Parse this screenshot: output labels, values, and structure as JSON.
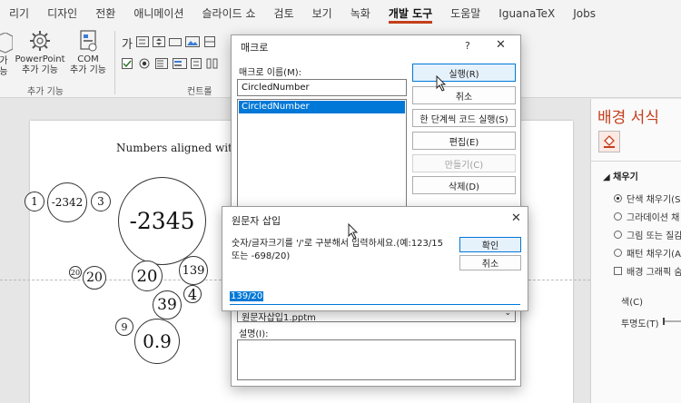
{
  "ribbon_tabs": [
    "리기",
    "디자인",
    "전환",
    "애니메이션",
    "슬라이드 쇼",
    "검토",
    "보기",
    "녹화",
    "개발 도구",
    "도움말",
    "IguanaTeX",
    "Jobs"
  ],
  "ribbon": {
    "addins_partial_line1": "가",
    "addins_partial_line2": "능",
    "powerpoint_addins_line1": "PowerPoint",
    "powerpoint_addins_line2": "추가 기능",
    "com_addins_line1": "COM",
    "com_addins_line2": "추가 기능",
    "group_addins": "추가 기능",
    "group_controls": "컨트롤",
    "control_text_glyph": "가"
  },
  "slide": {
    "title_visible": "Numbers aligned with",
    "numbers": {
      "n1": "1",
      "n2": "-2342",
      "n3": "3",
      "big": "-2345",
      "n20sup": "20",
      "n20a": "20",
      "n20b": "20",
      "n139": "139",
      "n4": "4",
      "n39": "39",
      "n9": "9",
      "n09": "0.9"
    }
  },
  "format_pane": {
    "title": "배경 서식",
    "section_fill": "채우기",
    "opt_solid": "단색 채우기(S",
    "opt_gradient": "그라데이션 채",
    "opt_picture": "그림 또는 질감",
    "opt_pattern": "패턴 채우기(A",
    "chk_hide": "배경 그래픽 숨",
    "color_label": "색(C)",
    "transparency_label": "투명도(T)"
  },
  "macro_dialog": {
    "title": "매크로",
    "help": "?",
    "close": "✕",
    "name_label": "매크로 이름(M):",
    "name_value": "CircledNumber",
    "list_items": [
      "CircledNumber"
    ],
    "btn_run": "실행(R)",
    "btn_cancel": "취소",
    "btn_step": "한 단계씩 코드 실행(S)",
    "btn_edit": "편집(E)",
    "btn_create": "만들기(C)",
    "btn_delete": "삭제(D)",
    "macro_in_value": "원문자삽입1.pptm",
    "desc_label": "설명(I):"
  },
  "input_dialog": {
    "title": "원문자 삽입",
    "close": "✕",
    "prompt": "숫자/글자크기를 '/'로 구분해서 입력하세요.(예:123/15 또는 -698/20)",
    "btn_ok": "확인",
    "btn_cancel": "취소",
    "value": "139/20"
  },
  "colors": {
    "accent": "#c43e1c",
    "selection": "#0078d7"
  }
}
